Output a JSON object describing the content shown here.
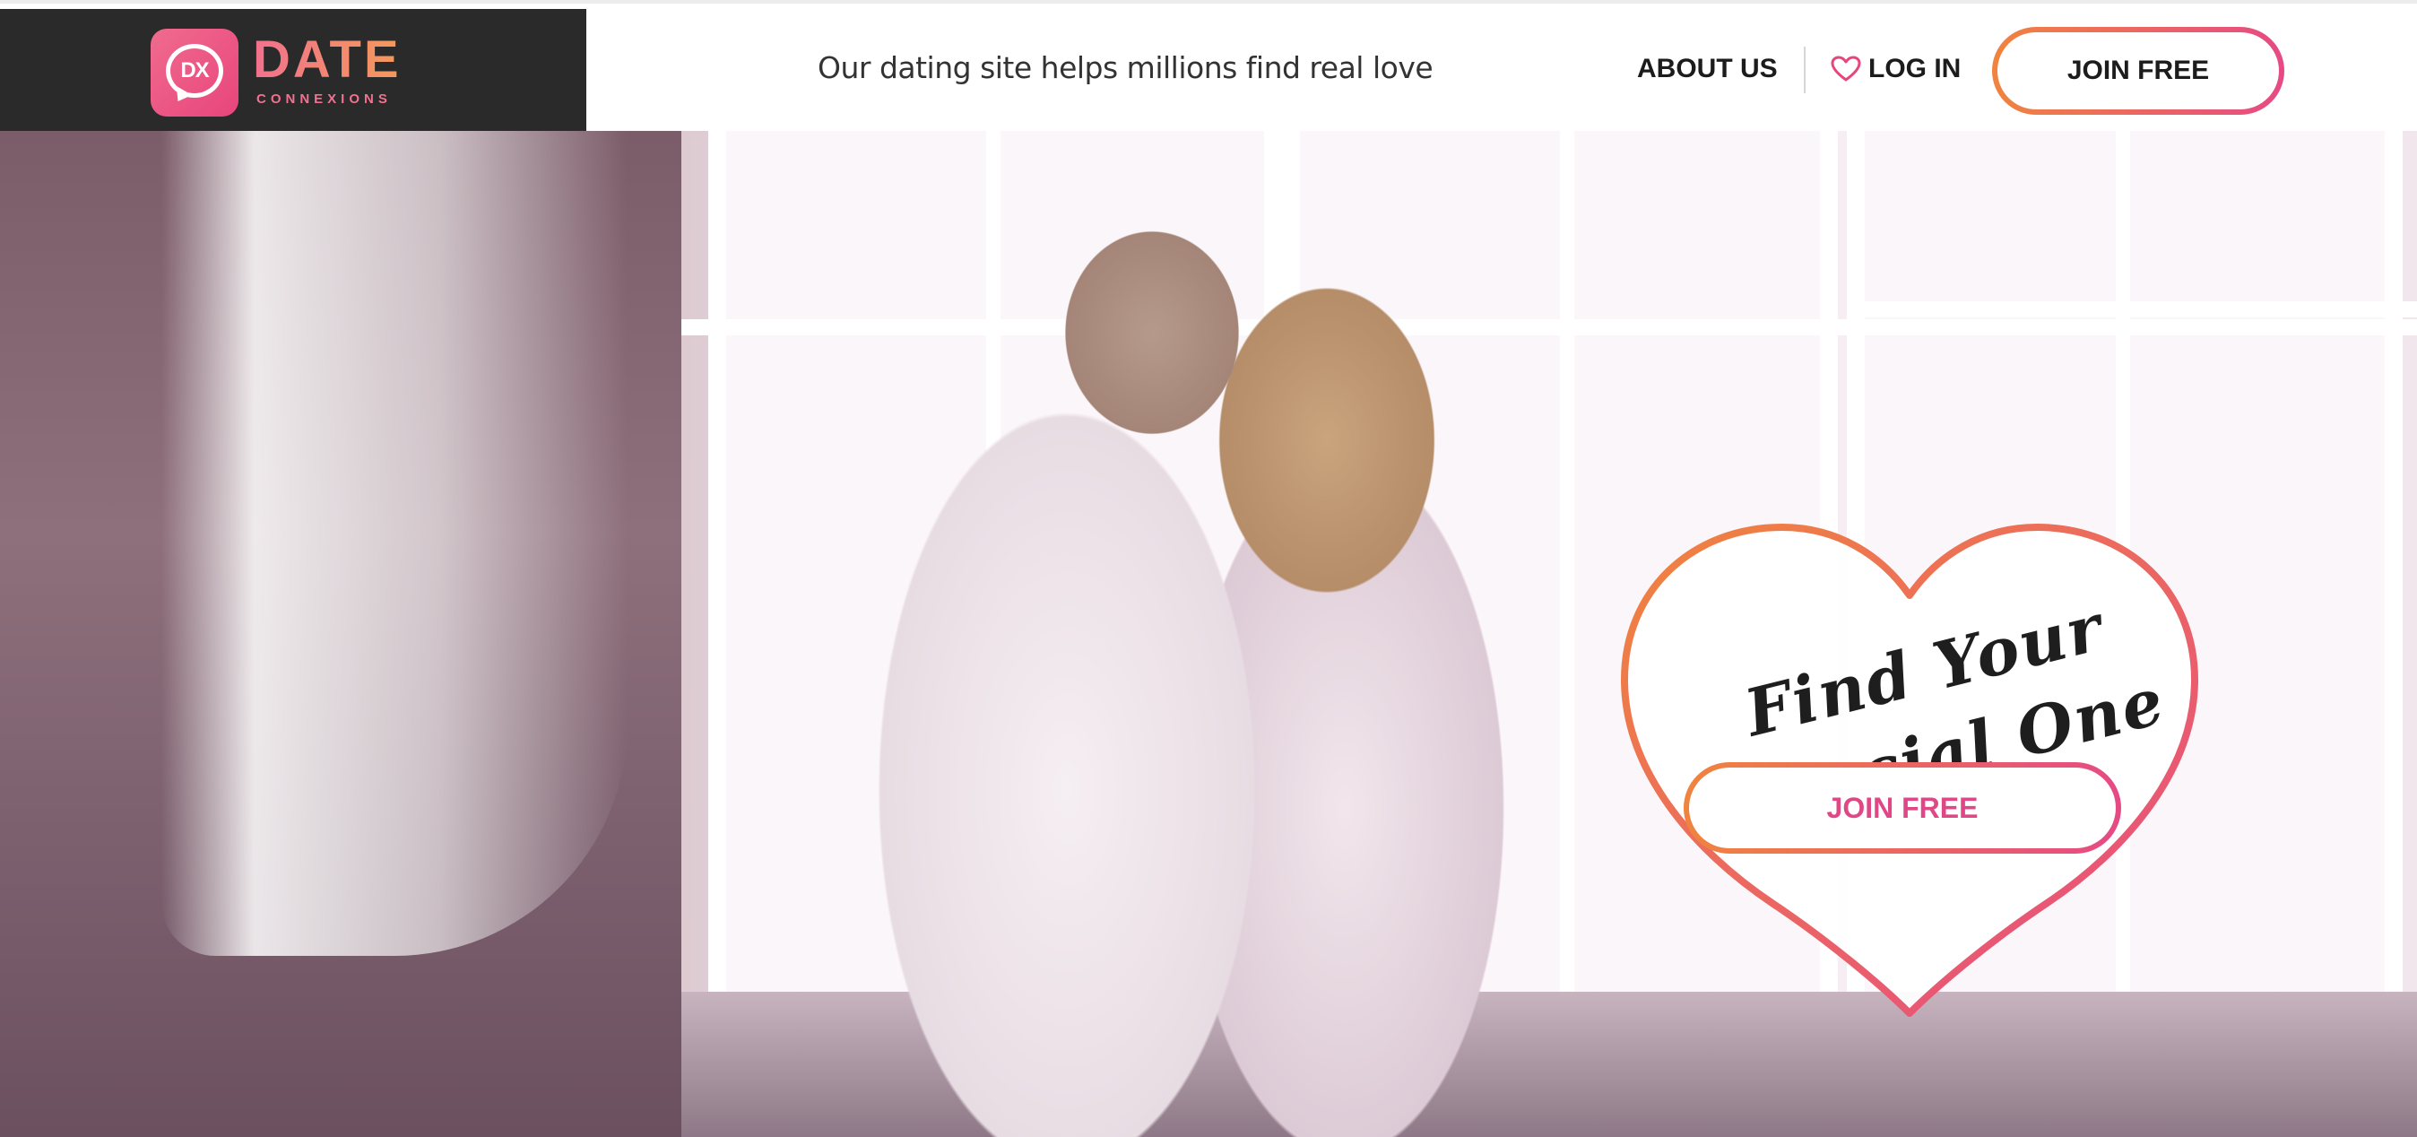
{
  "brand": {
    "badge_initials": "DX",
    "name": "DATE",
    "subname": "CONNEXIONS",
    "accent_pink": "#e8457c",
    "accent_orange": "#f0843e"
  },
  "header": {
    "tagline": "Our dating site helps millions find real love",
    "nav": {
      "about_label": "ABOUT US",
      "login_label": "LOG IN",
      "login_icon": "heart-outline-icon",
      "join_label": "JOIN FREE"
    }
  },
  "hero": {
    "image_subject": "couple-embracing-photo",
    "heading": "Find Your Special One",
    "cta_label": "JOIN FREE"
  }
}
